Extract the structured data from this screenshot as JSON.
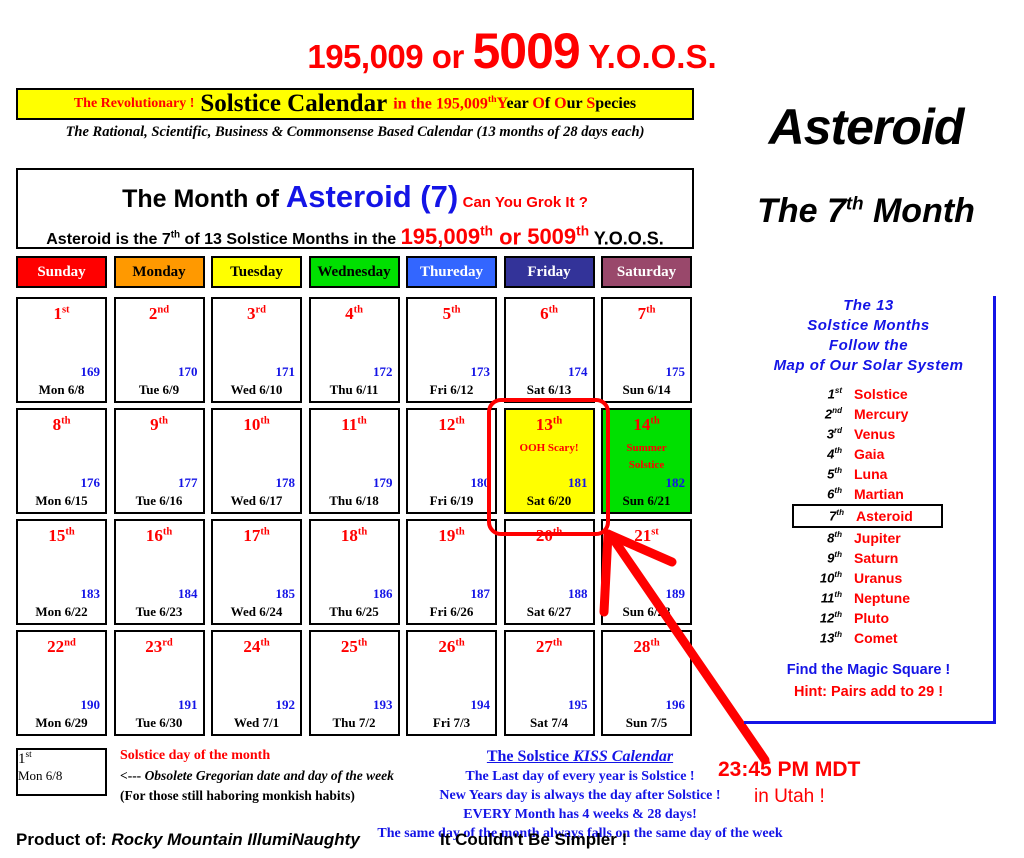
{
  "top_title": {
    "part1": "195,009 or ",
    "big": "5009",
    "part2": " Y.O.O.S."
  },
  "banner": {
    "revolutionary": "The Revolutionary !",
    "calendar_name": "Solstice Calendar",
    "in_the": "in the 195,009",
    "in_the_sup": "th",
    "year_of_our_species": "Year Of Our Species",
    "subtitle": "The Rational, Scientific, Business & Commonsense Based Calendar (13 months of 28 days each)"
  },
  "month_title": {
    "name": "Asteroid",
    "the": "The ",
    "ordinal": "7",
    "ordinal_sup": "th",
    "month_word": " Month"
  },
  "month_header": {
    "line1_a": "The Month of ",
    "line1_b": "Asteroid (7)",
    "line1_c": "Can You Grok It ?",
    "line2_a": "Asteroid is the 7",
    "line2_a_sup": "th",
    "line2_a2": " of 13 Solstice Months in the  ",
    "line2_b": "195,009",
    "line2_b_sup": "th",
    "line2_or": " or ",
    "line2_b2": "5009",
    "line2_b2_sup": "th",
    "line2_c": " Y.O.O.S."
  },
  "day_headers": [
    {
      "label": "Sunday",
      "bg": "#FF0000",
      "fg": "#FFFFFF"
    },
    {
      "label": "Monday",
      "bg": "#FF9900",
      "fg": "#000000"
    },
    {
      "label": "Tuesday",
      "bg": "#FFFF00",
      "fg": "#000000"
    },
    {
      "label": "Wednesday",
      "bg": "#00E000",
      "fg": "#000000"
    },
    {
      "label": "Thureday",
      "bg": "#3366FF",
      "fg": "#FFFFFF"
    },
    {
      "label": "Friday",
      "bg": "#333399",
      "fg": "#FFFFFF"
    },
    {
      "label": "Saturday",
      "bg": "#99486B",
      "fg": "#FFFFFF"
    }
  ],
  "weeks": [
    [
      {
        "day": "1",
        "sup": "st",
        "doy": "169",
        "greg": "Mon 6/8",
        "bg": "#FFFFFF",
        "note": ""
      },
      {
        "day": "2",
        "sup": "nd",
        "doy": "170",
        "greg": "Tue 6/9",
        "bg": "#FFFFFF",
        "note": ""
      },
      {
        "day": "3",
        "sup": "rd",
        "doy": "171",
        "greg": "Wed 6/10",
        "bg": "#FFFFFF",
        "note": ""
      },
      {
        "day": "4",
        "sup": "th",
        "doy": "172",
        "greg": "Thu 6/11",
        "bg": "#FFFFFF",
        "note": ""
      },
      {
        "day": "5",
        "sup": "th",
        "doy": "173",
        "greg": "Fri 6/12",
        "bg": "#FFFFFF",
        "note": ""
      },
      {
        "day": "6",
        "sup": "th",
        "doy": "174",
        "greg": "Sat 6/13",
        "bg": "#FFFFFF",
        "note": ""
      },
      {
        "day": "7",
        "sup": "th",
        "doy": "175",
        "greg": "Sun 6/14",
        "bg": "#FFFFFF",
        "note": ""
      }
    ],
    [
      {
        "day": "8",
        "sup": "th",
        "doy": "176",
        "greg": "Mon 6/15",
        "bg": "#FFFFFF",
        "note": ""
      },
      {
        "day": "9",
        "sup": "th",
        "doy": "177",
        "greg": "Tue 6/16",
        "bg": "#FFFFFF",
        "note": ""
      },
      {
        "day": "10",
        "sup": "th",
        "doy": "178",
        "greg": "Wed 6/17",
        "bg": "#FFFFFF",
        "note": ""
      },
      {
        "day": "11",
        "sup": "th",
        "doy": "179",
        "greg": "Thu 6/18",
        "bg": "#FFFFFF",
        "note": ""
      },
      {
        "day": "12",
        "sup": "th",
        "doy": "180",
        "greg": "Fri 6/19",
        "bg": "#FFFFFF",
        "note": ""
      },
      {
        "day": "13",
        "sup": "th",
        "doy": "181",
        "greg": "Sat 6/20",
        "bg": "#FFFF00",
        "note": "OOH Scary!"
      },
      {
        "day": "14",
        "sup": "th",
        "doy": "182",
        "greg": "Sun 6/21",
        "bg": "#00E000",
        "note": "Summer\nSolstice"
      }
    ],
    [
      {
        "day": "15",
        "sup": "th",
        "doy": "183",
        "greg": "Mon 6/22",
        "bg": "#FFFFFF",
        "note": ""
      },
      {
        "day": "16",
        "sup": "th",
        "doy": "184",
        "greg": "Tue 6/23",
        "bg": "#FFFFFF",
        "note": ""
      },
      {
        "day": "17",
        "sup": "th",
        "doy": "185",
        "greg": "Wed 6/24",
        "bg": "#FFFFFF",
        "note": ""
      },
      {
        "day": "18",
        "sup": "th",
        "doy": "186",
        "greg": "Thu 6/25",
        "bg": "#FFFFFF",
        "note": ""
      },
      {
        "day": "19",
        "sup": "th",
        "doy": "187",
        "greg": "Fri 6/26",
        "bg": "#FFFFFF",
        "note": ""
      },
      {
        "day": "20",
        "sup": "th",
        "doy": "188",
        "greg": "Sat 6/27",
        "bg": "#FFFFFF",
        "note": ""
      },
      {
        "day": "21",
        "sup": "st",
        "doy": "189",
        "greg": "Sun 6/28",
        "bg": "#FFFFFF",
        "note": ""
      }
    ],
    [
      {
        "day": "22",
        "sup": "nd",
        "doy": "190",
        "greg": "Mon 6/29",
        "bg": "#FFFFFF",
        "note": ""
      },
      {
        "day": "23",
        "sup": "rd",
        "doy": "191",
        "greg": "Tue 6/30",
        "bg": "#FFFFFF",
        "note": ""
      },
      {
        "day": "24",
        "sup": "th",
        "doy": "192",
        "greg": "Wed 7/1",
        "bg": "#FFFFFF",
        "note": ""
      },
      {
        "day": "25",
        "sup": "th",
        "doy": "193",
        "greg": "Thu 7/2",
        "bg": "#FFFFFF",
        "note": ""
      },
      {
        "day": "26",
        "sup": "th",
        "doy": "194",
        "greg": "Fri 7/3",
        "bg": "#FFFFFF",
        "note": ""
      },
      {
        "day": "27",
        "sup": "th",
        "doy": "195",
        "greg": "Sat 7/4",
        "bg": "#FFFFFF",
        "note": ""
      },
      {
        "day": "28",
        "sup": "th",
        "doy": "196",
        "greg": "Sun 7/5",
        "bg": "#FFFFFF",
        "note": ""
      }
    ]
  ],
  "sidebar": {
    "heading_lines": [
      "The 13",
      "Solstice Months",
      "Follow the",
      "Map of Our Solar System"
    ],
    "months": [
      {
        "ord": "1",
        "sup": "st",
        "name": "Solstice",
        "current": false
      },
      {
        "ord": "2",
        "sup": "nd",
        "name": "Mercury",
        "current": false
      },
      {
        "ord": "3",
        "sup": "rd",
        "name": "Venus",
        "current": false
      },
      {
        "ord": "4",
        "sup": "th",
        "name": "Gaia",
        "current": false
      },
      {
        "ord": "5",
        "sup": "th",
        "name": "Luna",
        "current": false
      },
      {
        "ord": "6",
        "sup": "th",
        "name": "Martian",
        "current": false
      },
      {
        "ord": "7",
        "sup": "th",
        "name": "Asteroid",
        "current": true
      },
      {
        "ord": "8",
        "sup": "th",
        "name": "Jupiter",
        "current": false
      },
      {
        "ord": "9",
        "sup": "th",
        "name": "Saturn",
        "current": false
      },
      {
        "ord": "10",
        "sup": "th",
        "name": "Uranus",
        "current": false
      },
      {
        "ord": "11",
        "sup": "th",
        "name": "Neptune",
        "current": false
      },
      {
        "ord": "12",
        "sup": "th",
        "name": "Pluto",
        "current": false
      },
      {
        "ord": "13",
        "sup": "th",
        "name": "Comet",
        "current": false
      }
    ],
    "magic_square": "Find the Magic Square !",
    "magic_hint": "Hint: Pairs add to 29 !"
  },
  "legend": {
    "cell_day": "1",
    "cell_day_sup": "st",
    "cell_greg": "Mon 6/8",
    "line1": "Solstice day of the month",
    "line2_arrow": "<--- ",
    "line2": "Obsolete Gregorian date and day of the week",
    "line3": "(For those still haboring monkish habits)"
  },
  "kiss": {
    "title_a": "The Solstice ",
    "title_b": "KISS Calendar",
    "lines": [
      "The Last day of every year is Solstice !",
      "New Years day is always the day after Solstice !",
      "EVERY Month has 4 weeks & 28 days!",
      "The same day of the month always falls on the same day of the week"
    ]
  },
  "time_note": {
    "line1": "23:45 PM MDT",
    "line2": "in Utah !"
  },
  "footer": {
    "product_label": "Product of:  ",
    "product_name": "Rocky Mountain IllumiNaughty",
    "tagline": "It Couldn't Be Simpler !"
  },
  "colors": {
    "red": "#FF0000",
    "blue": "#1414E6",
    "yellow": "#FFFF00",
    "green": "#00E000",
    "black": "#000000"
  }
}
